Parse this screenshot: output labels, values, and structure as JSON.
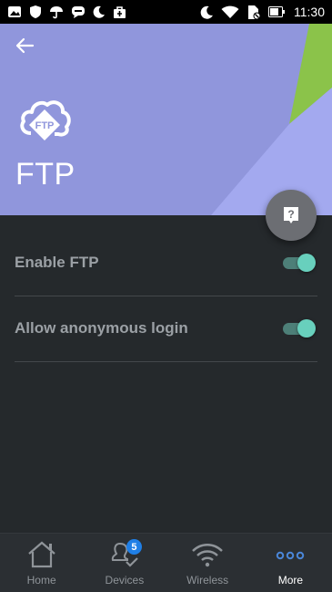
{
  "status_bar": {
    "time": "11:30",
    "left_icons": [
      "image-icon",
      "shield-icon",
      "umbrella-icon",
      "chat-icon",
      "moon-icon",
      "bag-icon"
    ],
    "right_icons": [
      "moon-icon",
      "wifi-icon",
      "sim-blocked-icon",
      "battery-icon"
    ]
  },
  "header": {
    "title": "FTP",
    "logo_text": "FTP",
    "background_color": "#9096dc",
    "accent_color": "#8bc34a"
  },
  "settings": [
    {
      "label": "Enable FTP",
      "enabled": true
    },
    {
      "label": "Allow anonymous login",
      "enabled": true
    }
  ],
  "bottom_nav": {
    "items": [
      {
        "label": "Home",
        "icon": "home-icon",
        "active": false
      },
      {
        "label": "Devices",
        "icon": "devices-icon",
        "badge": "5",
        "active": false
      },
      {
        "label": "Wireless",
        "icon": "wifi-icon",
        "active": false
      },
      {
        "label": "More",
        "icon": "more-icon",
        "active": true
      }
    ]
  },
  "colors": {
    "toggle_on": "#68d0bd",
    "badge": "#1f7fe6",
    "more_icon": "#4a86d8"
  }
}
